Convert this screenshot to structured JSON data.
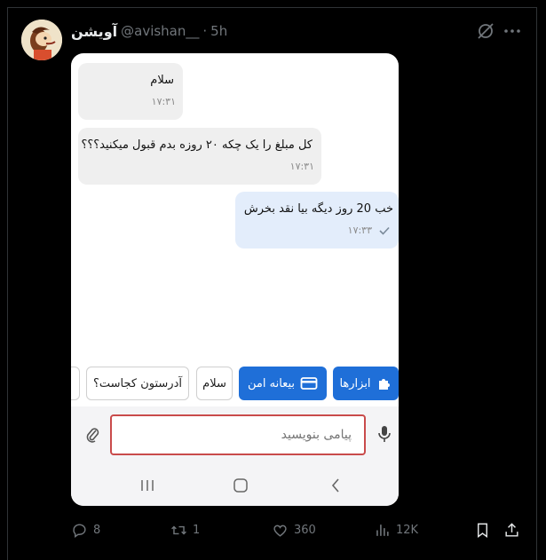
{
  "tweet": {
    "display_name": "آویشن",
    "handle": "@avishan__",
    "separator": "·",
    "time": "5h",
    "icons": {
      "avatar": "user-avatar",
      "grok": "grok-icon",
      "more": "more-icon"
    }
  },
  "chat": {
    "messages": [
      {
        "direction": "incoming",
        "text": "سلام",
        "time": "۱۷:۳۱"
      },
      {
        "direction": "incoming",
        "text": "کل مبلغ را یک چکه ۲۰ روزه بدم قبول میکنید؟؟؟",
        "time": "۱۷:۳۱"
      },
      {
        "direction": "outgoing",
        "text": "خب 20 روز دیگه بیا نقد بخرش",
        "time": "۱۷:۳۳",
        "status_icon": "check-icon"
      }
    ],
    "chips": [
      {
        "label": "ابزارها",
        "icon": "puzzle-icon",
        "style": "primary"
      },
      {
        "label": "بیعانه امن",
        "icon": "card-icon",
        "style": "primary"
      },
      {
        "label": "سلام",
        "style": "outline"
      },
      {
        "label": "آدرستون کجاست؟",
        "style": "outline"
      }
    ],
    "input": {
      "placeholder": "پیامی بنویسید",
      "value": ""
    },
    "icons": {
      "attach": "paperclip-icon",
      "mic": "microphone-icon"
    },
    "nav": {
      "recents": "recents-icon",
      "home": "home-icon",
      "back": "back-icon"
    }
  },
  "actions": {
    "reply": {
      "icon": "reply-icon",
      "count": "8"
    },
    "repost": {
      "icon": "repost-icon",
      "count": "1"
    },
    "like": {
      "icon": "heart-icon",
      "count": "360"
    },
    "views": {
      "icon": "views-icon",
      "count": "12K"
    },
    "bookmark": {
      "icon": "bookmark-icon"
    },
    "share": {
      "icon": "share-icon"
    }
  },
  "colors": {
    "accent": "#1f6fd8",
    "input_border": "#c94b4b",
    "outgoing_bubble": "#e3edfb",
    "incoming_bubble": "#efefef"
  }
}
